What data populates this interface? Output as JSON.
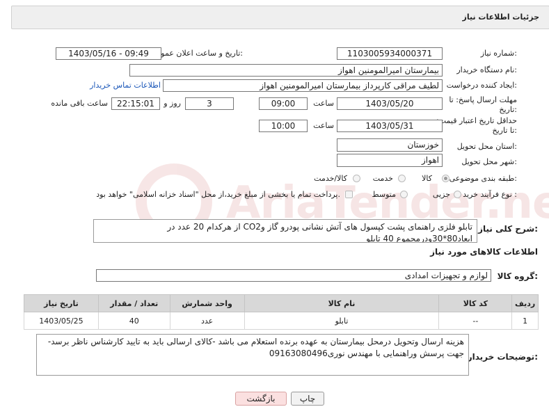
{
  "header": {
    "title": "جزئیات اطلاعات نیاز"
  },
  "form": {
    "need_number_label": "شماره نیاز:",
    "need_number": "1103005934000371",
    "announce_label": "تاریخ و ساعت اعلان عمومی:",
    "announce_value": "1403/05/16 - 09:49",
    "buyer_org_label": "نام دستگاه خریدار:",
    "buyer_org": "بیمارستان امیرالمومنین اهواز",
    "creator_label": "ایجاد کننده درخواست:",
    "creator": "لطیف مراقی کارپرداز بیمارستان امیرالمومنین اهواز",
    "contact_link": "اطلاعات تماس خریدار",
    "deadline_label": "مهلت ارسال پاسخ: تا تاریخ:",
    "deadline_date": "1403/05/20",
    "time_label": "ساعت",
    "deadline_time": "09:00",
    "days_value": "3",
    "days_label": "روز و",
    "remaining_time": "22:15:01",
    "remaining_label": "ساعت باقی مانده",
    "min_price_label": "حداقل تاریخ اعتبار قیمت: تا تاریخ:",
    "min_price_date": "1403/05/31",
    "min_price_time": "10:00",
    "province_label": "استان محل تحویل:",
    "province": "خوزستان",
    "city_label": "شهر محل تحویل:",
    "city": "اهواز",
    "category_label": "طبقه بندی موضوعی:",
    "category_options": [
      "کالا",
      "خدمت",
      "کالا/خدمت"
    ],
    "process_label": "نوع فرآیند خرید :",
    "process_options": [
      "جزیی",
      "متوسط"
    ],
    "payment_note": "پرداخت تمام یا بخشی از مبلغ خرید،از محل \"اسناد خزانه اسلامی\" خواهد بود."
  },
  "description": {
    "label": "شرح کلی نیاز:",
    "text": "تابلو فلزی راهنمای پشت کپسول های آتش نشانی پودرو گاز وCO2 از هرکدام 20 عدد در ابعاد80*30ودرمجموع 40 تابلو"
  },
  "goods_section": {
    "title": "اطلاعات کالاهای مورد نیاز",
    "group_label": "گروه کالا:",
    "group_value": "لوازم و تجهیزات امدادی"
  },
  "table": {
    "headers": [
      "ردیف",
      "کد کالا",
      "نام کالا",
      "واحد شمارش",
      "تعداد / مقدار",
      "تاریخ نیاز"
    ],
    "rows": [
      [
        "1",
        "--",
        "تابلو",
        "عدد",
        "40",
        "1403/05/25"
      ]
    ]
  },
  "buyer_notes": {
    "label": "توضیحات خریدار:",
    "text": "هزینه ارسال وتحویل درمحل بیمارستان به عهده برنده استعلام می باشد -کالای ارسالی باید به تایید کارشناس ناظر برسد-جهت پرسش وراهنمایی با مهندس نوری09163080496"
  },
  "buttons": {
    "print": "چاپ",
    "back": "بازگشت"
  },
  "watermark": {
    "text": "AriaTender.neT"
  }
}
